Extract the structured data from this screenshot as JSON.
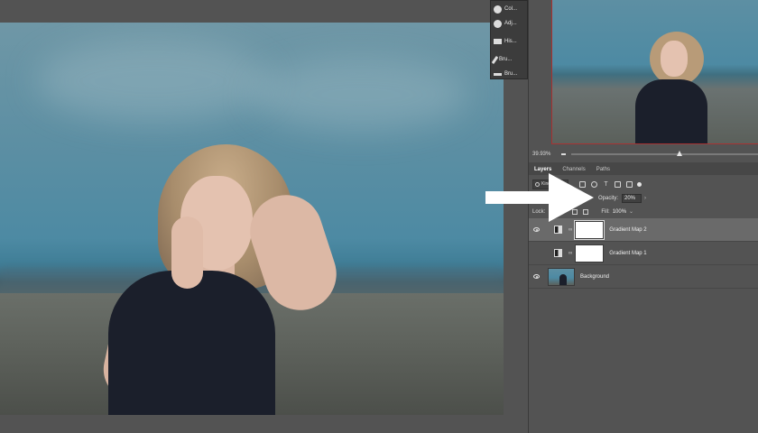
{
  "tool_strip": {
    "items": [
      {
        "label": "Col...",
        "icon": "color-swatch-icon"
      },
      {
        "label": "Adj...",
        "icon": "adjustments-icon"
      },
      {
        "label": "His...",
        "icon": "histogram-icon"
      },
      {
        "label": "Bru...",
        "icon": "brush-icon"
      },
      {
        "label": "Bru...",
        "icon": "brush-settings-icon"
      }
    ]
  },
  "navigator": {
    "zoom": "39.93%",
    "zoom_level": 0.58
  },
  "layers_panel": {
    "tabs": [
      {
        "label": "Layers",
        "active": true
      },
      {
        "label": "Channels",
        "active": false
      },
      {
        "label": "Paths",
        "active": false
      }
    ],
    "filter": {
      "kind_label": "Kind"
    },
    "opacity": {
      "label": "Opacity:",
      "value": "20%"
    },
    "lock": {
      "label": "Lock:"
    },
    "fill": {
      "label": "Fill:",
      "value": "100%"
    },
    "layers": [
      {
        "name": "Gradient Map 2",
        "visible": true,
        "selected": true,
        "type": "adjustment"
      },
      {
        "name": "Gradient Map 1",
        "visible": false,
        "selected": false,
        "type": "adjustment"
      },
      {
        "name": "Background",
        "visible": true,
        "selected": false,
        "type": "image"
      }
    ]
  },
  "colors": {
    "panel_bg": "#535353",
    "selected_row": "#6a6a6a",
    "arrow": "#ffffff"
  }
}
